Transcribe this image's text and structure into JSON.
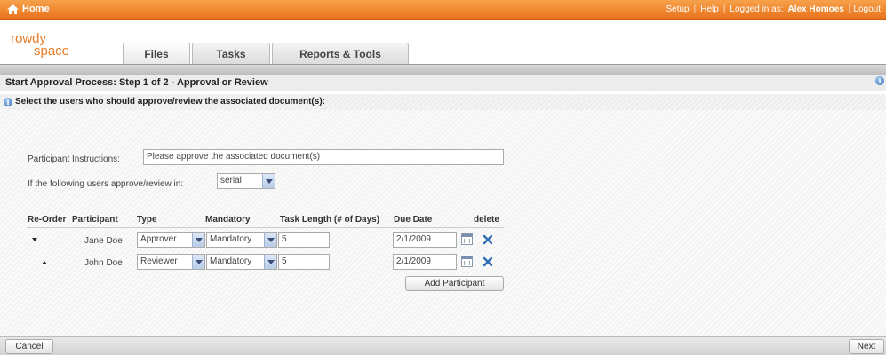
{
  "topbar": {
    "home_label": "Home",
    "links": [
      "Setup",
      "Help",
      "Logged in as:"
    ],
    "separator": "|",
    "user_name": "Alex Homoes",
    "logout_label": "[ Logout"
  },
  "logo": {
    "line1": "rowdy",
    "line2": "space"
  },
  "tabs": [
    {
      "label": "Files",
      "active": true
    },
    {
      "label": "Tasks",
      "active": false
    },
    {
      "label": "Reports & Tools",
      "active": false
    }
  ],
  "page": {
    "title": "Start Approval Process: Step 1 of 2 - Approval or Review",
    "subtitle": "Select the users who should approve/review the associated document(s):"
  },
  "form": {
    "instructions_label": "Participant Instructions:",
    "instructions_value": "Please approve the associated document(s)",
    "order_label": "If the following users approve/review in:",
    "order_value": "serial"
  },
  "table": {
    "headers": [
      "Re-Order",
      "Participant",
      "Type",
      "Mandatory",
      "Task Length (# of Days)",
      "Due Date",
      "delete"
    ],
    "rows": [
      {
        "participant": "Jane Doe",
        "type": "Approver",
        "mandatory": "Mandatory",
        "task_length": "5",
        "due_date": "2/1/2009"
      },
      {
        "participant": "John Doe",
        "type": "Reviewer",
        "mandatory": "Mandatory",
        "task_length": "5",
        "due_date": "2/1/2009"
      }
    ]
  },
  "add_participant_label": "Add Participant",
  "footer": {
    "cancel_label": "Cancel",
    "next_label": "Next"
  },
  "colors": {
    "accent": "#ea7a23",
    "info_blue": "#2f6db6"
  }
}
